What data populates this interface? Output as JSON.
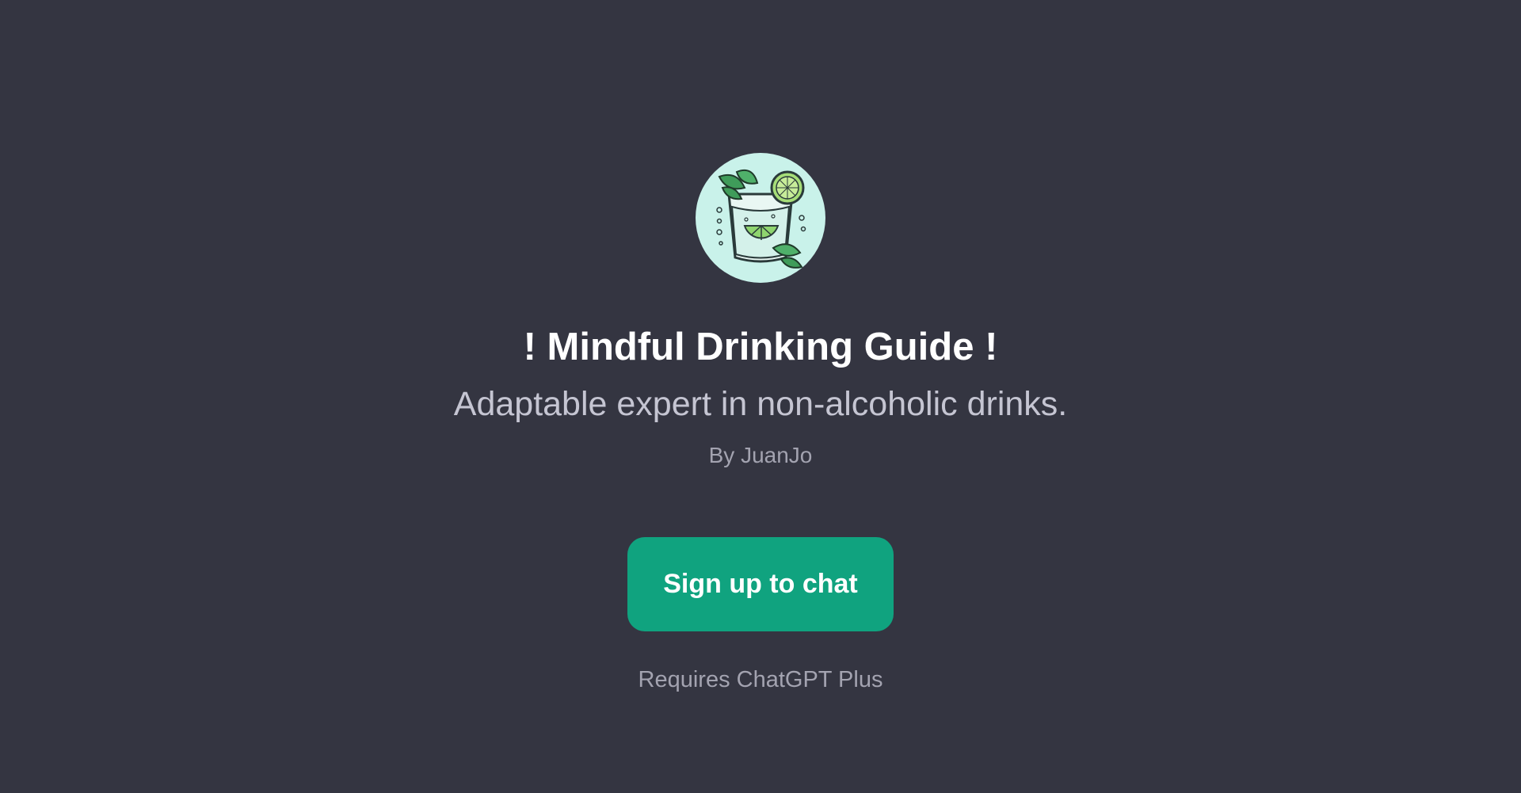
{
  "gpt": {
    "avatar_icon": "mojito-glass-icon",
    "title": "! Mindful Drinking Guide !",
    "description": "Adaptable expert in non-alcoholic drinks.",
    "author": "By JuanJo"
  },
  "cta": {
    "label": "Sign up to chat"
  },
  "footer": {
    "requirement": "Requires ChatGPT Plus"
  },
  "colors": {
    "background": "#343541",
    "accent": "#10a37f",
    "avatar_bg": "#c9f2ea"
  }
}
